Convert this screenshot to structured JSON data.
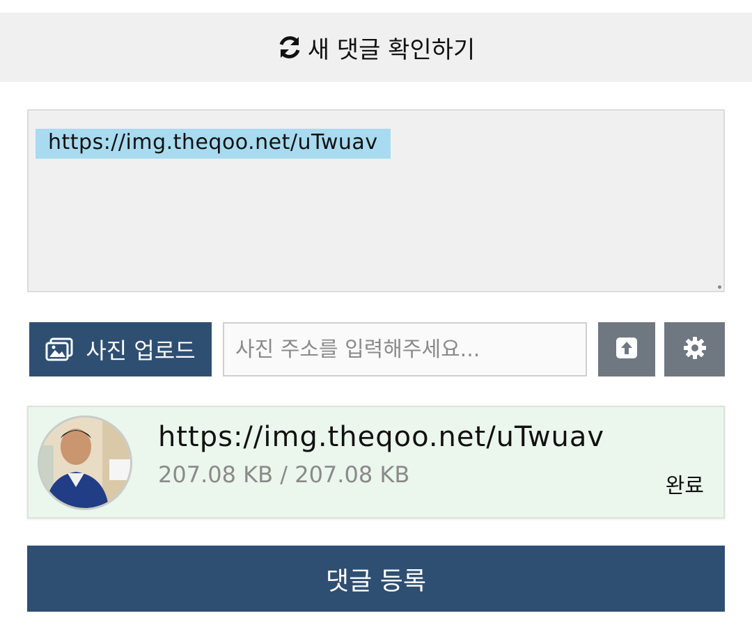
{
  "refresh": {
    "label": "새 댓글 확인하기",
    "icon": "refresh-icon"
  },
  "comment": {
    "text": "https://img.theqoo.net/uTwuav"
  },
  "upload": {
    "button_label": "사진 업로드",
    "icon": "image-upload-icon",
    "url_placeholder": "사진 주소를 입력해주세요...",
    "send_icon": "arrow-up-icon",
    "settings_icon": "gear-icon"
  },
  "file": {
    "name": "https://img.theqoo.net/uTwuav",
    "size": "207.08 KB / 207.08 KB",
    "status": "완료",
    "progress": 1.0
  },
  "submit": {
    "label": "댓글 등록"
  },
  "colors": {
    "primary": "#2f4f72",
    "icon_button": "#6f7880",
    "file_bg": "#ebf6ec",
    "selection": "#a8dbf0"
  }
}
